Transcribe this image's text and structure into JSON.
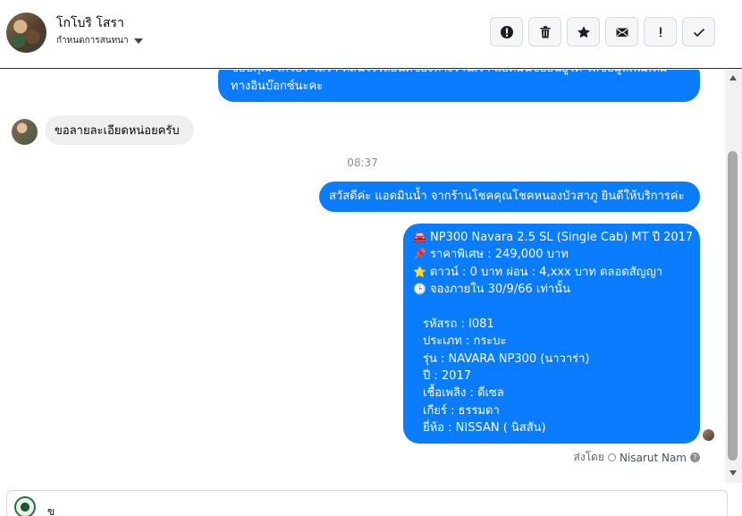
{
  "header": {
    "contact_name": "โกโบริ โสรา",
    "assign_label": "กำหนดการสนทนา"
  },
  "toolbar": {
    "buttons": [
      "report",
      "delete",
      "star",
      "mark-unread",
      "important",
      "done"
    ]
  },
  "messages": {
    "m1_lines": [
      "ขอบคุณ โกโบริ โสรา ที่สนใจรถยนต์ของทางร้านเรา แอดมินขอยินยูโต ให้ข้อมูลเพิ่มเติม",
      "ทางอินบ๊อกซ์นะคะ"
    ],
    "m2": "ขอลายละเอียดหน่อยครับ",
    "timestamp": "08:37",
    "m3": "สวัสดีค่ะ แอดมินน้ำ จากร้านโชคคุณโชคหนองบัวสาภู ยินดีให้บริการค่ะ",
    "m4_lines": [
      {
        "emoji": "🚘",
        "text": "NP300 Navara 2.5 SL (Single Cab) MT ปี 2017"
      },
      {
        "emoji": "📌",
        "text": "ราคาพิเศษ : 249,000 บาท"
      },
      {
        "emoji": "⭐",
        "text": "ดาวน์ : 0 บาท ผ่อน : 4,xxx บาท ตลอดสัญญา"
      },
      {
        "emoji": "🕒",
        "text": "จองภายใน 30/9/66 เท่านั้น"
      },
      {
        "emoji": "",
        "text": ""
      },
      {
        "emoji": "",
        "text": "รหัสรถ : I081"
      },
      {
        "emoji": "",
        "text": "ประเภท : กระบะ"
      },
      {
        "emoji": "",
        "text": "รุ่น : NAVARA NP300 (นาวาร่า)"
      },
      {
        "emoji": "",
        "text": "ปี : 2017"
      },
      {
        "emoji": "",
        "text": "เชื้อเพลิง : ดีเซล"
      },
      {
        "emoji": "",
        "text": "เกียร์ : ธรรมดา"
      },
      {
        "emoji": "",
        "text": "ยี่ห้อ : NISSAN ( นิสสัน)"
      }
    ],
    "sent_by_label": "ส่งโดย",
    "sent_by_name": "Nisarut Nam"
  },
  "composer": {
    "text": "ข"
  },
  "colors": {
    "outgoing_bubble": "#0a7cff",
    "incoming_bubble": "#efefef"
  }
}
